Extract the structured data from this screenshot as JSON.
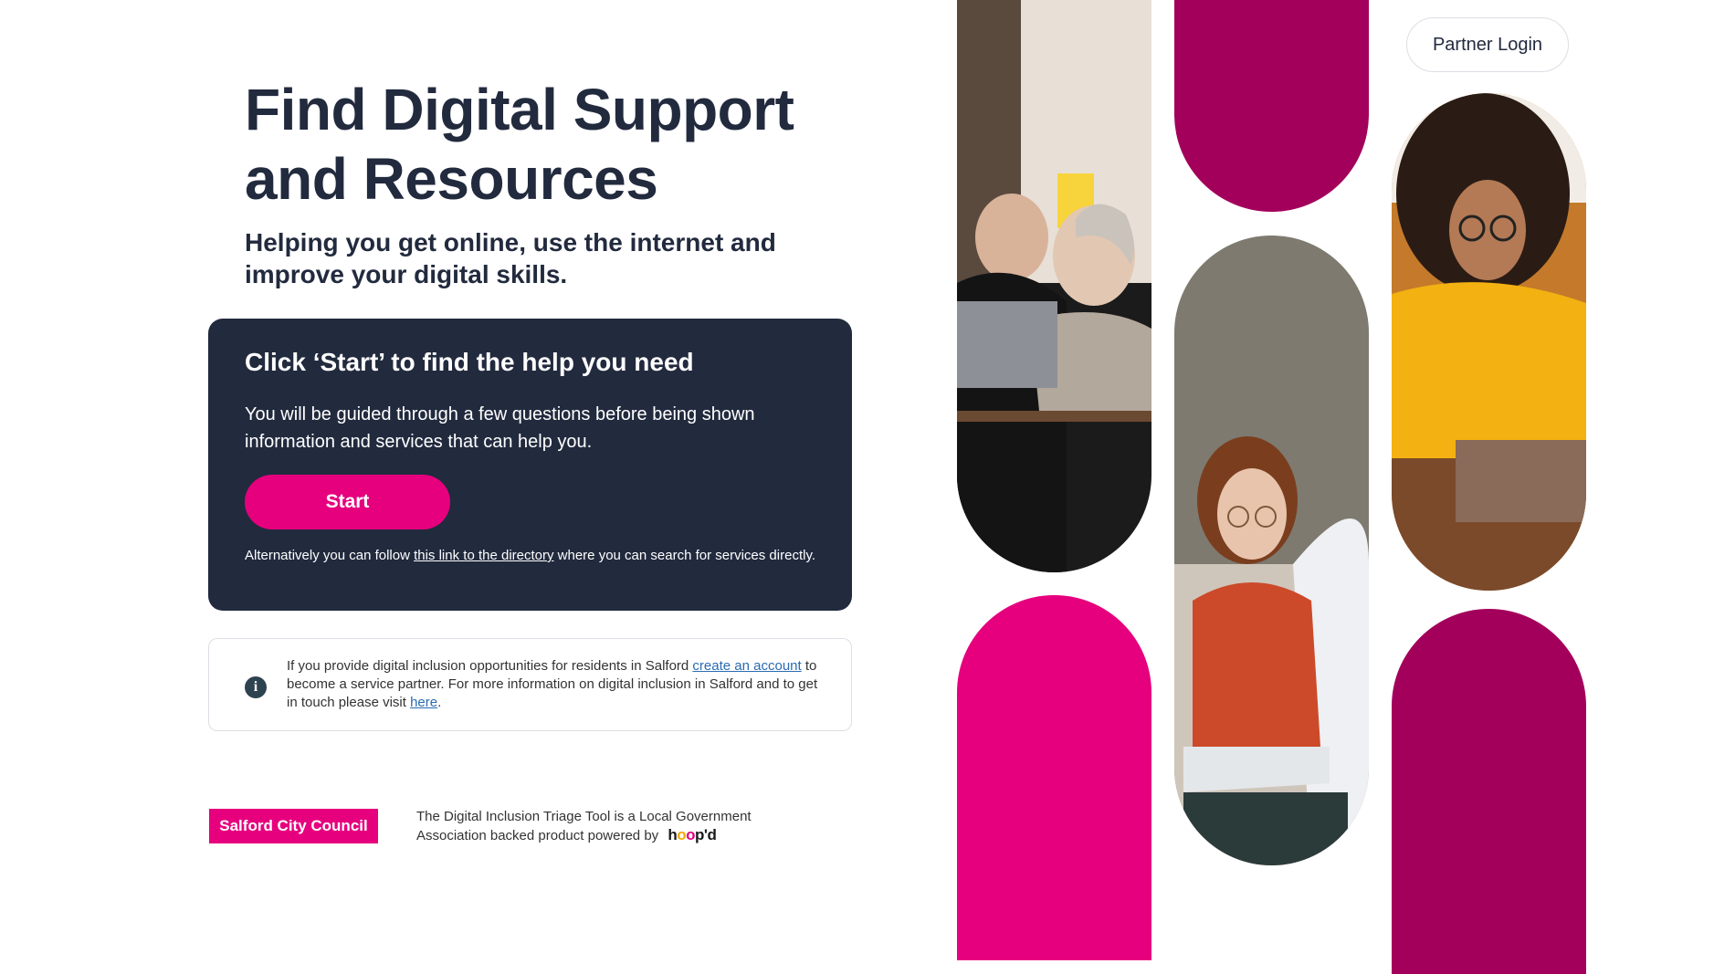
{
  "hero": {
    "title": "Find Digital Support and Resources",
    "subtitle": "Helping you get online, use the internet and improve your digital skills."
  },
  "cta": {
    "title": "Click ‘Start’ to find the help you need",
    "text": "You will be guided through a few questions before being shown information and services that can help you.",
    "start_label": "Start",
    "alt_prefix": "Alternatively you can follow ",
    "alt_link": "this link to the directory",
    "alt_suffix": " where you can search for services directly."
  },
  "info": {
    "text_1": "If you provide digital inclusion opportunities for residents in Salford ",
    "link_1": "create an account",
    "text_2": " to become a service partner. For more information on digital inclusion in Salford and to get in touch please visit ",
    "link_2": "here",
    "text_3": "."
  },
  "footer": {
    "council": "Salford City Council",
    "text": "The Digital Inclusion Triage Tool is a Local Government Association backed product powered by",
    "brand": "hoop'd"
  },
  "header": {
    "partner_login": "Partner Login"
  },
  "colors": {
    "navy": "#222a3e",
    "pink": "#e6007e",
    "berry": "#a3005c",
    "white": "#ffffff"
  }
}
